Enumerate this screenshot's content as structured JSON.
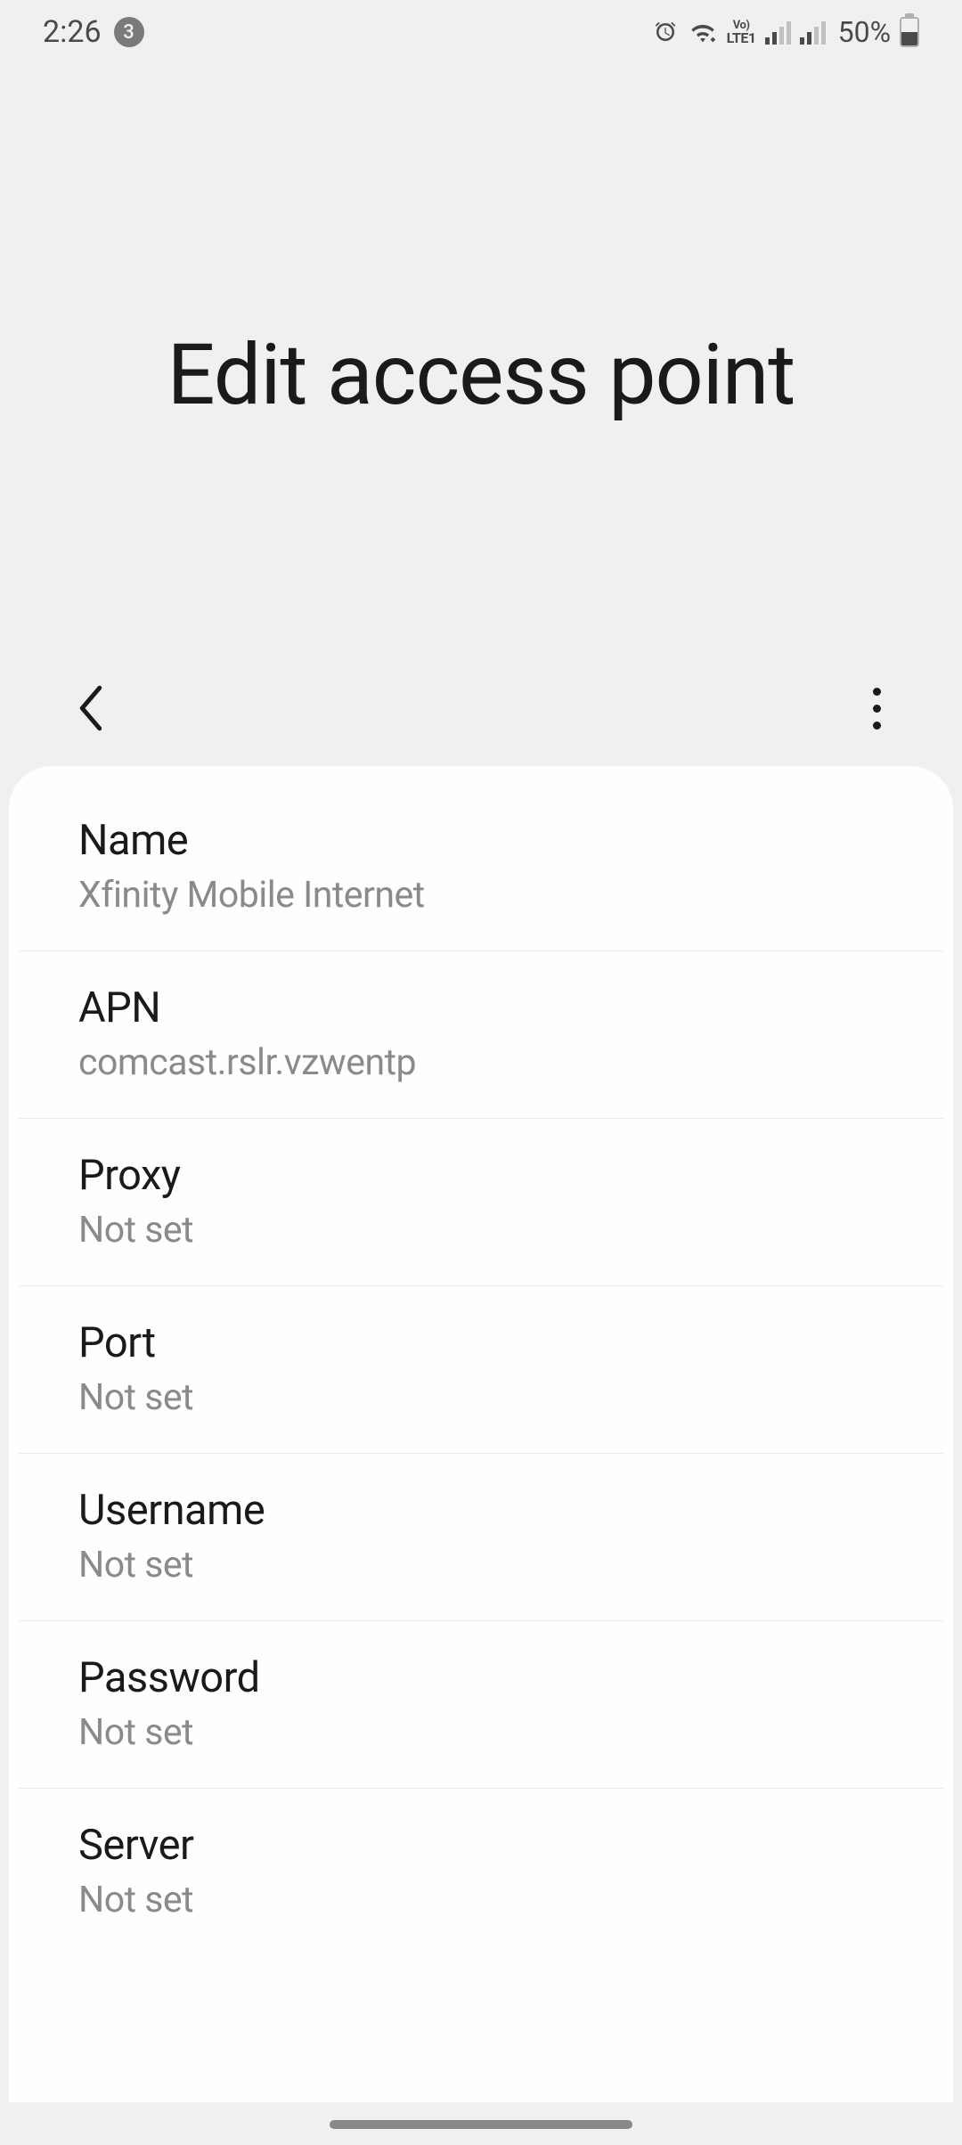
{
  "statusBar": {
    "time": "2:26",
    "notificationCount": "3",
    "battery": "50%"
  },
  "header": {
    "title": "Edit access point"
  },
  "settings": [
    {
      "label": "Name",
      "value": "Xfinity Mobile Internet"
    },
    {
      "label": "APN",
      "value": "comcast.rslr.vzwentp"
    },
    {
      "label": "Proxy",
      "value": "Not set"
    },
    {
      "label": "Port",
      "value": "Not set"
    },
    {
      "label": "Username",
      "value": "Not set"
    },
    {
      "label": "Password",
      "value": "Not set"
    },
    {
      "label": "Server",
      "value": "Not set"
    }
  ]
}
